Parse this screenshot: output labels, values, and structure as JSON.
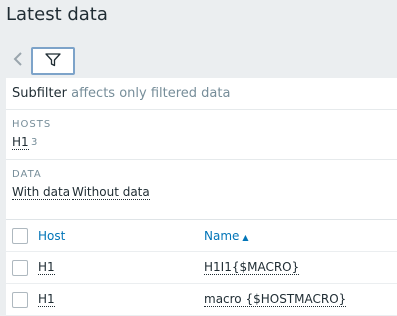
{
  "page": {
    "title": "Latest data"
  },
  "filter": {
    "prev_icon": "chevron-left-icon",
    "filter_icon": "funnel-icon"
  },
  "subfilter": {
    "label": "Subfilter",
    "hint": "affects only filtered data",
    "hosts": {
      "title": "HOSTS",
      "items": [
        {
          "label": "H1",
          "count": "3"
        }
      ]
    },
    "data": {
      "title": "DATA",
      "items": [
        {
          "label": "With data"
        },
        {
          "label": "Without data"
        }
      ]
    }
  },
  "table": {
    "columns": {
      "host": "Host",
      "name": "Name",
      "name_sort": "▲"
    },
    "rows": [
      {
        "host": "H1",
        "name": "H1I1{$MACRO}"
      },
      {
        "host": "H1",
        "name": "macro {$HOSTMACRO}"
      }
    ]
  }
}
